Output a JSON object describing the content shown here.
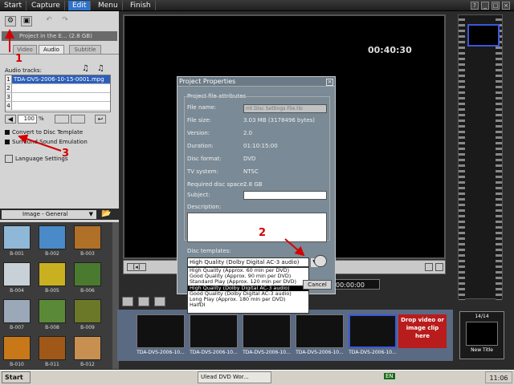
{
  "nav": {
    "tabs": [
      "Start",
      "Capture",
      "Edit",
      "Menu",
      "Finish"
    ],
    "active": "Edit"
  },
  "left_panel": {
    "file_strip": "Project in the E... (2.8 GB)",
    "subtabs": [
      "Video",
      "Audio",
      "Subtitle"
    ],
    "audio_tracks_label": "Audio tracks:",
    "tracks": [
      {
        "num": "1",
        "name": "TDA-DVS-2006-10-15-0001.mpg"
      },
      {
        "num": "2",
        "name": ""
      },
      {
        "num": "3",
        "name": ""
      },
      {
        "num": "4",
        "name": ""
      }
    ],
    "volume": "100",
    "volume_unit": "%",
    "convert_label": "Convert to Disc Template",
    "surround_label": "Surround Sound Emulation",
    "language_label": "Language Settings",
    "library_title": "Image - General",
    "thumbs": [
      {
        "label": "B-001",
        "color": "#8fb8d8"
      },
      {
        "label": "B-002",
        "color": "#4a8ac8"
      },
      {
        "label": "B-003",
        "color": "#b07028"
      },
      {
        "label": "B-004",
        "color": "#c8d0d8"
      },
      {
        "label": "B-005",
        "color": "#c8b020"
      },
      {
        "label": "B-006",
        "color": "#4a7a30"
      },
      {
        "label": "B-007",
        "color": "#9aa8b8"
      },
      {
        "label": "B-008",
        "color": "#5a8a38"
      },
      {
        "label": "B-009",
        "color": "#6a7828"
      },
      {
        "label": "B-010",
        "color": "#c87818"
      },
      {
        "label": "B-011",
        "color": "#a05818"
      },
      {
        "label": "B-012",
        "color": "#c89050"
      }
    ]
  },
  "preview": {
    "timecode": "00:40:30",
    "timecode_bottom": "00:00:00"
  },
  "dialog": {
    "title": "Project Properties",
    "group_label": "Project file attributes",
    "fields": [
      {
        "key": "File name:",
        "value": "mt Disc Settings File.hb"
      },
      {
        "key": "File size:",
        "value": "3.03 MB (3178496 bytes)"
      },
      {
        "key": "Version:",
        "value": "2.0"
      },
      {
        "key": "Duration:",
        "value": "01:10:15:00"
      },
      {
        "key": "Disc format:",
        "value": "DVD"
      },
      {
        "key": "TV system:",
        "value": "NTSC"
      },
      {
        "key": "Required disc space:",
        "value": "2.8 GB"
      }
    ],
    "subject_label": "Subject:",
    "description_label": "Description:",
    "templates_label": "Disc templates:",
    "selected_template": "High Quality (Dolby Digital AC-3 audio)",
    "options": [
      "High Quality (Approx. 60 min per DVD)",
      "Good Quality (Approx. 90 min per DVD)",
      "Standard Play (Approx. 120 min per DVD)",
      "High Quality (Dolby Digital AC-3 audio)",
      "Good Quality (Dolby Digital AC-3 audio)",
      "Long Play (Approx. 180 min per DVD)",
      "HalfDI"
    ],
    "selected_option_index": 3,
    "cancel_label": "Cancel"
  },
  "storyboard": {
    "clips": [
      {
        "label": "TDA-DVS-2006-10..."
      },
      {
        "label": "TDA-DVS-2006-10..."
      },
      {
        "label": "TDA-DVS-2006-10..."
      },
      {
        "label": "TDA-DVS-2006-10..."
      },
      {
        "label": "TDA-DVS-2006-10..."
      }
    ],
    "drop_text": "Drop video or image clip here",
    "new_title_counter": "14/14",
    "new_title_label": "New Title"
  },
  "annotations": [
    "1",
    "2",
    "3"
  ],
  "taskbar": {
    "start": "Start",
    "tasks": [
      "Ulead DVD Wor..."
    ],
    "clock": "11:06",
    "lang": "EN"
  }
}
